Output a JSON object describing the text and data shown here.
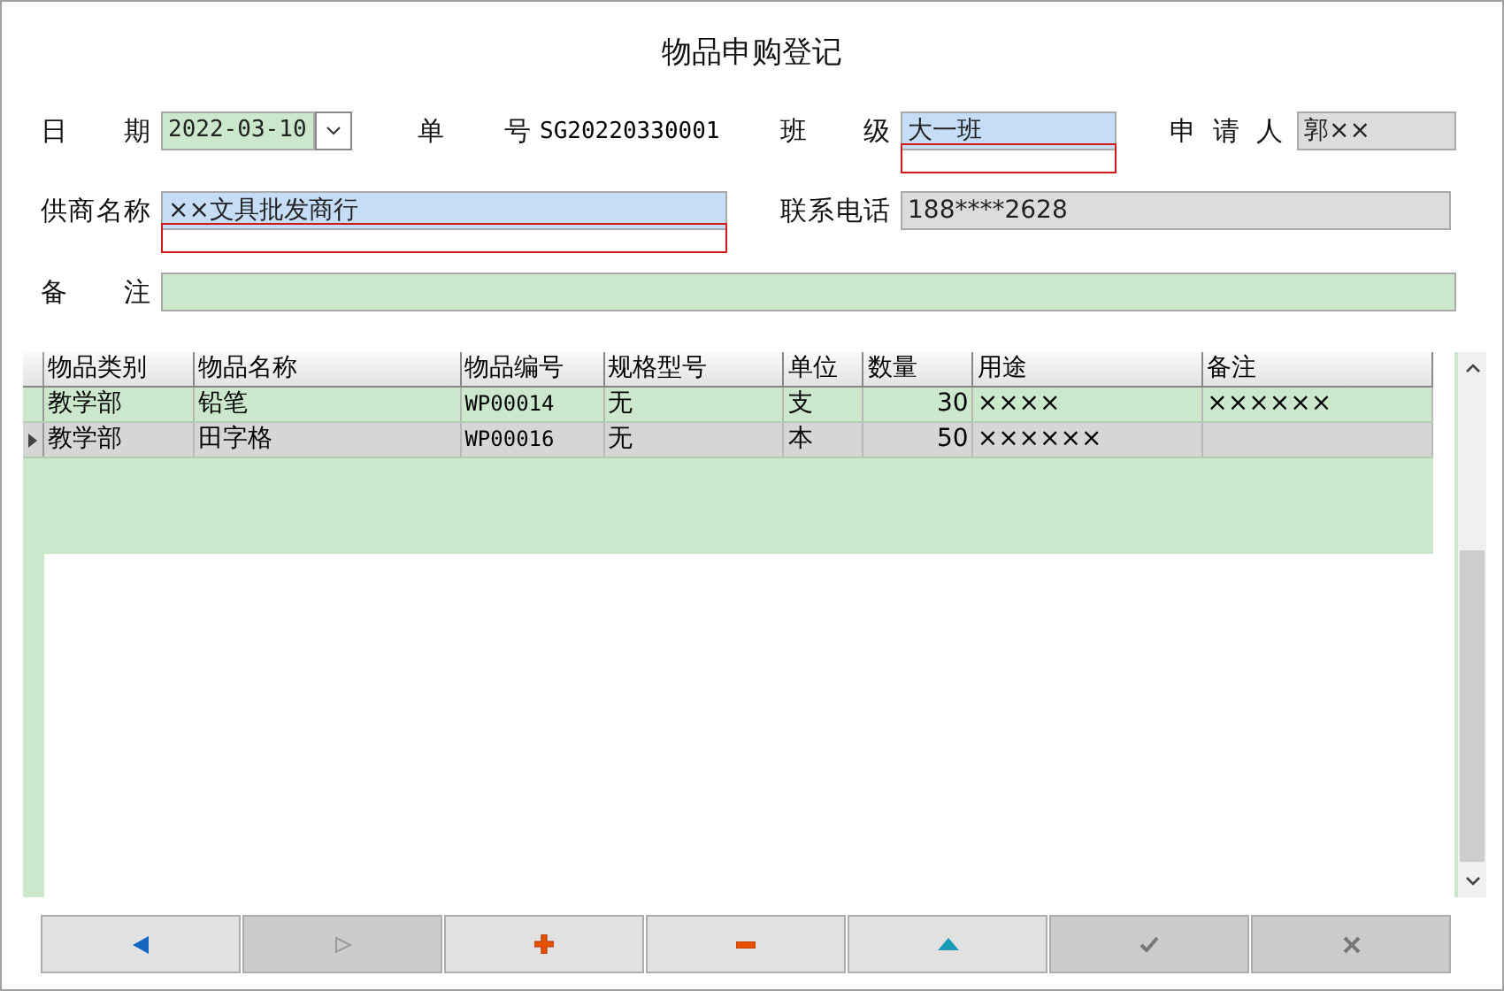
{
  "window": {
    "title": "物品申购登记"
  },
  "form": [
    [
      {
        "label": "日期",
        "kind": "date",
        "value": "2022-03-10",
        "annotated": false
      },
      {
        "label": "单号",
        "kind": "plain",
        "value": "SG20220330001",
        "annotated": false
      },
      {
        "label": "班级",
        "kind": "selected",
        "value": "大一班",
        "annotated": true
      },
      {
        "label": "申请人",
        "kind": "readonly",
        "value": "郭××",
        "annotated": false
      }
    ],
    [
      {
        "label": "供商名称",
        "kind": "selected",
        "value": "××文具批发商行",
        "annotated": true
      },
      {
        "label": "联系电话",
        "kind": "readonly",
        "value": "188****2628",
        "annotated": false
      }
    ],
    [
      {
        "label": "备注",
        "kind": "editable",
        "annotated": false
      }
    ]
  ],
  "table": {
    "columns": [
      "物品类别",
      "物品名称",
      "物品编号",
      "规格型号",
      "单位",
      "数量",
      "用途",
      "备注"
    ],
    "rows": [
      {
        "selected": false,
        "cells": [
          "教学部",
          "铅笔",
          "WP00014",
          "无",
          "支",
          "30",
          "××××",
          "××××××"
        ]
      },
      {
        "selected": true,
        "cells": [
          "教学部",
          "田字格",
          "WP00016",
          "无",
          "本",
          "50",
          "××××××",
          ""
        ]
      }
    ]
  },
  "buttons": [
    {
      "kind": "previous",
      "disabled": false
    },
    {
      "kind": "next",
      "disabled": true
    },
    {
      "kind": "add",
      "disabled": false
    },
    {
      "kind": "remove",
      "disabled": false
    },
    {
      "kind": "up",
      "disabled": false
    },
    {
      "kind": "confirm",
      "disabled": true
    },
    {
      "kind": "cancel",
      "disabled": true
    }
  ]
}
